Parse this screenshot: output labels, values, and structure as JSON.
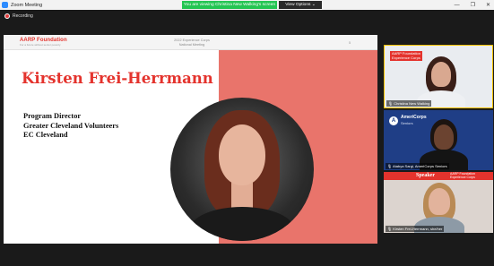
{
  "window": {
    "title": "Zoom Meeting",
    "banner": "You are viewing Christina New Walking's screen",
    "view_options": "View Options ⌄",
    "controls": [
      "—",
      "❐",
      "✕"
    ]
  },
  "recording": {
    "label": "Recording",
    "color": "#e03a3a"
  },
  "slide": {
    "header": {
      "logo": "AARP Foundation",
      "logo_tagline": "For a future without senior poverty",
      "meeting_title_line1": "2022 Experience Corps",
      "meeting_title_line2": "National Meeting",
      "page_number": "5"
    },
    "speaker_name": "Kirsten Frei-Herrmann",
    "role_lines": [
      "Program Director",
      "Greater Cleveland Volunteers",
      "EC Cleveland"
    ],
    "colors": {
      "accent": "#e4332d",
      "panel": "#e9746b"
    }
  },
  "participants": [
    {
      "name": "Christina New Walking",
      "logo": "AARP Foundation",
      "logo_sub": "Experience Corps",
      "icon": "mic-muted-icon"
    },
    {
      "name": "Atabya Sargi, AmeriCorps Seniors",
      "logo": "AmeriCorps",
      "logo_sub": "Seniors",
      "icon": "mic-muted-icon"
    },
    {
      "name": "Kirsten Frei-Herrmann, she/her",
      "banner": "Speaker",
      "logo": "AARP Foundation",
      "logo_sub": "Experience Corps",
      "icon": "mic-icon"
    }
  ]
}
